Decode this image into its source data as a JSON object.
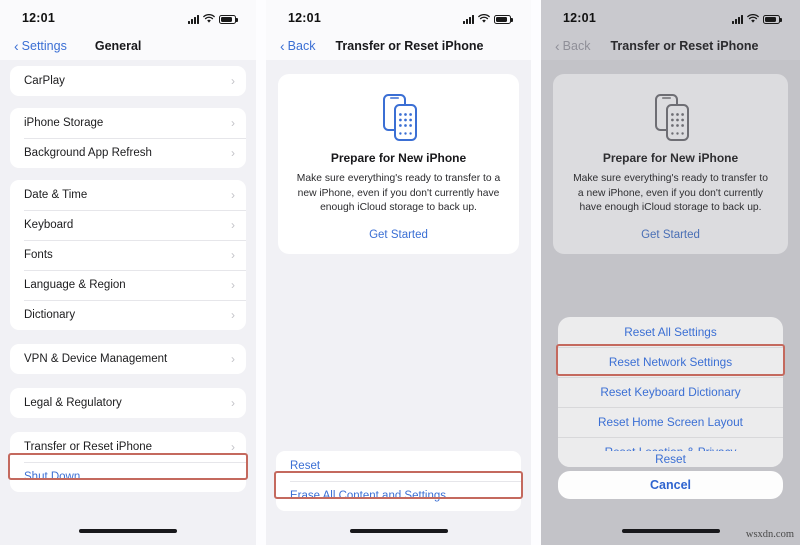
{
  "meta": {
    "watermark": "wsxdn.com"
  },
  "theme": {
    "accent_blue": "#3b6fd4",
    "highlight_red": "#c4695e",
    "list_bg": "#ffffff",
    "page_bg": "#f1f1f5",
    "dim_overlay": "#6c6c70"
  },
  "status_bar": {
    "time": "12:01",
    "icons": [
      "cellular-bars-icon",
      "wifi-icon",
      "battery-icon"
    ]
  },
  "panels": [
    {
      "id": "general-settings",
      "nav": {
        "back_label": "Settings",
        "title": "General",
        "back_icon": "chevron-left-icon"
      },
      "groups": [
        {
          "rows": [
            {
              "label": "CarPlay",
              "accessory": "chevron-right-icon"
            }
          ]
        },
        {
          "rows": [
            {
              "label": "iPhone Storage",
              "accessory": "chevron-right-icon"
            },
            {
              "label": "Background App Refresh",
              "accessory": "chevron-right-icon"
            }
          ]
        },
        {
          "rows": [
            {
              "label": "Date & Time",
              "accessory": "chevron-right-icon"
            },
            {
              "label": "Keyboard",
              "accessory": "chevron-right-icon"
            },
            {
              "label": "Fonts",
              "accessory": "chevron-right-icon"
            },
            {
              "label": "Language & Region",
              "accessory": "chevron-right-icon"
            },
            {
              "label": "Dictionary",
              "accessory": "chevron-right-icon"
            }
          ]
        },
        {
          "rows": [
            {
              "label": "VPN & Device Management",
              "accessory": "chevron-right-icon"
            }
          ]
        },
        {
          "rows": [
            {
              "label": "Legal & Regulatory",
              "accessory": "chevron-right-icon"
            }
          ]
        },
        {
          "rows": [
            {
              "label": "Transfer or Reset iPhone",
              "accessory": "chevron-right-icon",
              "highlighted": true
            },
            {
              "label": "Shut Down",
              "style": "blue"
            }
          ]
        }
      ]
    },
    {
      "id": "transfer-or-reset",
      "nav": {
        "back_label": "Back",
        "title": "Transfer or Reset iPhone",
        "back_icon": "chevron-left-icon"
      },
      "card": {
        "icon": "two-phones-transfer-icon",
        "title": "Prepare for New iPhone",
        "description": "Make sure everything's ready to transfer to a new iPhone, even if you don't currently have enough iCloud storage to back up.",
        "link": "Get Started"
      },
      "bottom_rows": [
        {
          "label": "Reset",
          "style": "blue",
          "highlighted": true
        },
        {
          "label": "Erase All Content and Settings",
          "style": "blue"
        }
      ]
    },
    {
      "id": "transfer-or-reset-sheet",
      "dimmed": true,
      "nav": {
        "back_label": "Back",
        "title": "Transfer or Reset iPhone",
        "back_icon": "chevron-left-icon"
      },
      "card": {
        "icon": "two-phones-transfer-icon",
        "title": "Prepare for New iPhone",
        "description": "Make sure everything's ready to transfer to a new iPhone, even if you don't currently have enough iCloud storage to back up.",
        "link": "Get Started"
      },
      "action_sheet": {
        "items": [
          {
            "label": "Reset All Settings"
          },
          {
            "label": "Reset Network Settings",
            "highlighted": true
          },
          {
            "label": "Reset Keyboard Dictionary"
          },
          {
            "label": "Reset Home Screen Layout"
          },
          {
            "label": "Reset Location & Privacy"
          }
        ],
        "obscured_item": "Reset",
        "cancel_label": "Cancel"
      }
    }
  ]
}
